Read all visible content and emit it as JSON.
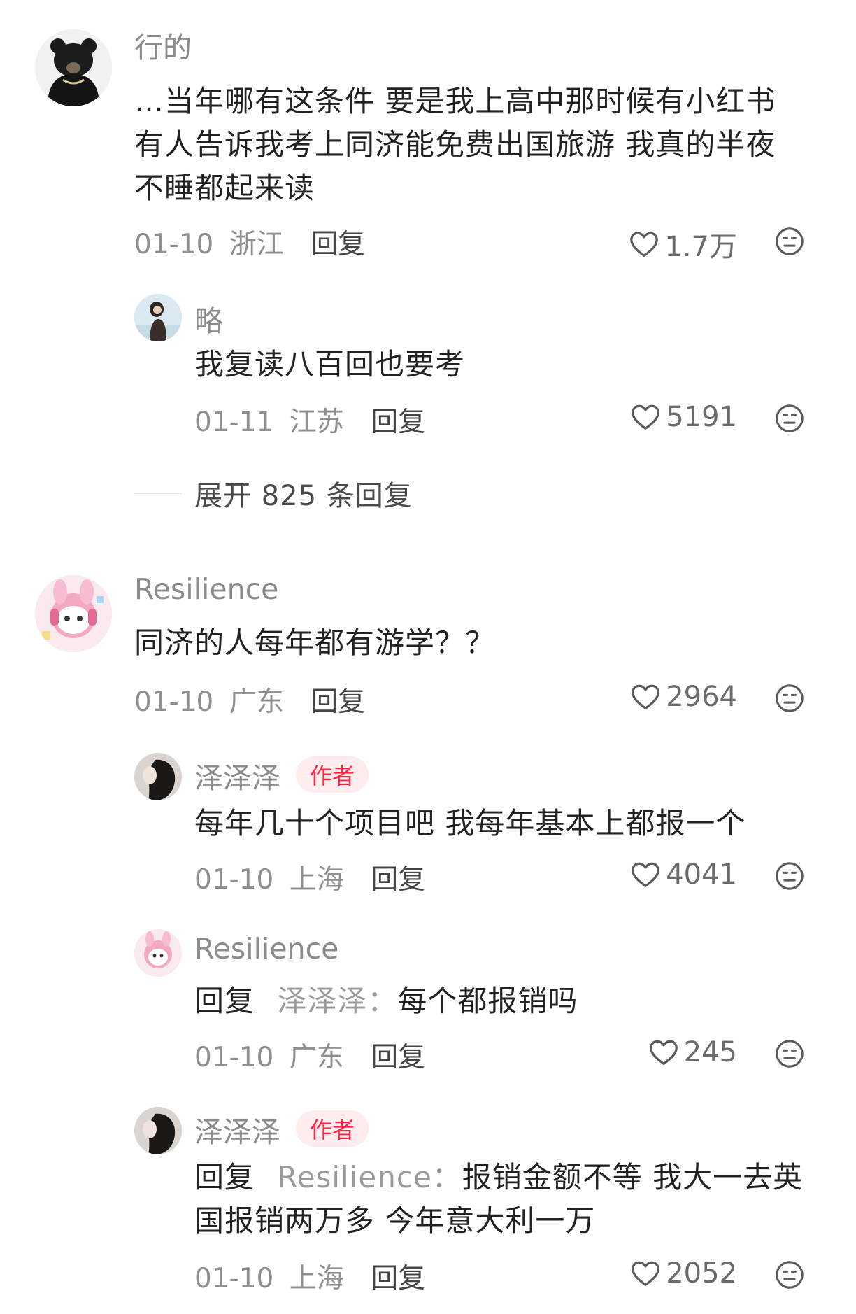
{
  "comments": [
    {
      "name": "行的",
      "text": "…当年哪有这条件 要是我上高中那时候有小红书有人告诉我考上同济能免费出国旅游 我真的半夜不睡都起来读",
      "date": "01-10",
      "location": "浙江",
      "reply_label": "回复",
      "likes": "1.7万",
      "replies": [
        {
          "name": "略",
          "text": "我复读八百回也要考",
          "date": "01-11",
          "location": "江苏",
          "reply_label": "回复",
          "likes": "5191"
        }
      ],
      "expand_label": "展开 825 条回复"
    },
    {
      "name": "Resilience",
      "text": "同济的人每年都有游学？？",
      "date": "01-10",
      "location": "广东",
      "reply_label": "回复",
      "likes": "2964",
      "replies": [
        {
          "name": "泽泽泽",
          "badge": "作者",
          "text": "每年几十个项目吧 我每年基本上都报一个",
          "date": "01-10",
          "location": "上海",
          "reply_label": "回复",
          "likes": "4041"
        },
        {
          "name": "Resilience",
          "reply_prefix": "回复",
          "reply_to": "泽泽泽：",
          "text": "每个都报销吗",
          "date": "01-10",
          "location": "广东",
          "reply_label": "回复",
          "likes": "245"
        },
        {
          "name": "泽泽泽",
          "badge": "作者",
          "reply_prefix": "回复",
          "reply_to": "Resilience：",
          "text": "报销金额不等 我大一去英国报销两万多 今年意大利一万",
          "date": "01-10",
          "location": "上海",
          "reply_label": "回复",
          "likes": "2052"
        }
      ]
    }
  ],
  "icons": {
    "like": "heart-outline-icon",
    "emoji": "neutral-face-icon"
  },
  "colors": {
    "author_badge_text": "#ff2442",
    "author_badge_bg": "#ffecef",
    "username": "#8c8c8c",
    "body_text": "#222222"
  }
}
